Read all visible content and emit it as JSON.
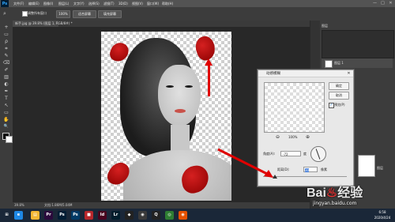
{
  "app": {
    "logo": "Ps"
  },
  "menu": [
    "文件(F)",
    "编辑(E)",
    "图像(I)",
    "图层(L)",
    "文字(Y)",
    "选择(S)",
    "滤镜(T)",
    "3D(D)",
    "视图(V)",
    "窗口(W)",
    "帮助(H)"
  ],
  "window_controls": [
    "—",
    "□",
    "✕"
  ],
  "options_bar": {
    "checkbox_label": "调整所有窗口",
    "zoom": "100%",
    "fit_screen": "适合屏幕",
    "fill_screen": "填充屏幕"
  },
  "document_tab": {
    "label": "新手.jpg @ 39.8% (图层 1, RGB/8#) *"
  },
  "status": {
    "zoom": "39.8%",
    "doc_info": "文档:1.86M/5.04M"
  },
  "tools": [
    "+",
    "▭",
    "ρ",
    "⌗",
    "✎",
    "⌫",
    "✐",
    "▥",
    "◐",
    "✒",
    "T",
    "↖",
    "▭",
    "✋",
    "🔍"
  ],
  "right_panel": {
    "layers_tab": "图层",
    "layer_name": "图层 1",
    "bg_label": "图层"
  },
  "dialog": {
    "title": "动感模糊",
    "ok": "确定",
    "cancel": "取消",
    "preview_label": "预览(P)",
    "zoom": "100%",
    "angle_label": "角度(A):",
    "angle_value": "-72",
    "angle_unit": "度",
    "distance_label": "距离(D):",
    "distance_value": "30",
    "distance_unit": "像素"
  },
  "watermark": "Bai&#37117;经验 jingyan.baidu.com",
  "taskbar": {
    "icons": [
      {
        "name": "start-icon",
        "glyph": "⊞",
        "color": "#1a2738"
      },
      {
        "name": "ie-icon",
        "glyph": "e",
        "color": "#1e88e5"
      },
      {
        "name": "folder-icon",
        "glyph": "▤",
        "color": "#f2b632"
      },
      {
        "name": "premiere-icon",
        "glyph": "Pr",
        "color": "#2a0a3c"
      },
      {
        "name": "photoshop-icon",
        "glyph": "Ps",
        "color": "#001d34"
      },
      {
        "name": "photoshop-active-icon",
        "glyph": "Ps",
        "color": "#003a66"
      },
      {
        "name": "media-icon",
        "glyph": "■",
        "color": "#b8272c"
      },
      {
        "name": "indesign-icon",
        "glyph": "Id",
        "color": "#49021f"
      },
      {
        "name": "lightroom-icon",
        "glyph": "Lr",
        "color": "#001d2c"
      },
      {
        "name": "app-icon",
        "glyph": "◆",
        "color": "#222"
      },
      {
        "name": "game-icon",
        "glyph": "◉",
        "color": "#3a3a3a"
      },
      {
        "name": "qq-icon",
        "glyph": "Q",
        "color": "#222"
      },
      {
        "name": "chrome-icon",
        "glyph": "◎",
        "color": "#2e7d32"
      },
      {
        "name": "firefox-icon",
        "glyph": "◉",
        "color": "#e65100"
      }
    ],
    "time": "6:58",
    "date": "2020/4/24"
  }
}
